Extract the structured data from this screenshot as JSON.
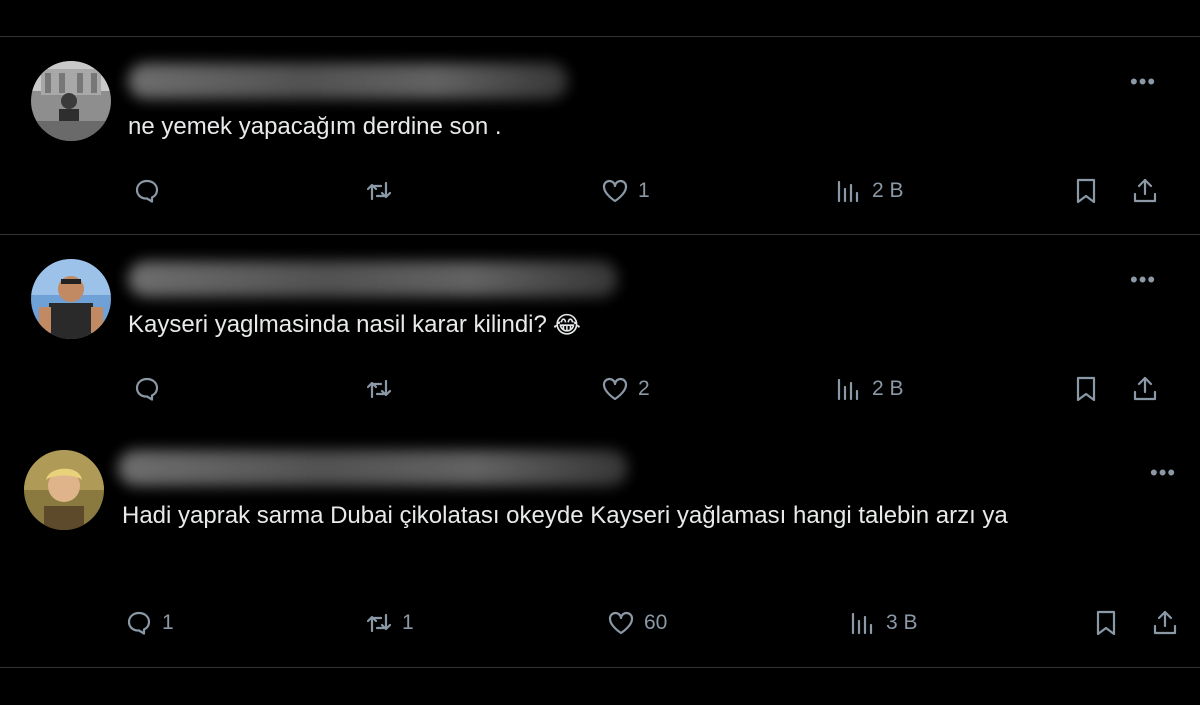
{
  "posts": [
    {
      "text": "ne yemek yapacağım derdine son .",
      "more": "•••",
      "replies": "",
      "reposts": "",
      "likes": "1",
      "views": "2 B"
    },
    {
      "text": "Kayseri yaglmasinda nasil karar kilindi?",
      "emoji": "😂",
      "more": "•••",
      "replies": "",
      "reposts": "",
      "likes": "2",
      "views": "2 B"
    },
    {
      "text": "Hadi yaprak sarma Dubai çikolatası okeyde Kayseri yağlaması hangi talebin arzı ya",
      "more": "•••",
      "replies": "1",
      "reposts": "1",
      "likes": "60",
      "views": "3 B"
    }
  ],
  "icons": {
    "reply": "speech-bubble-icon",
    "repost": "repost-arrows-icon",
    "like": "heart-icon",
    "views": "bar-chart-icon",
    "bookmark": "bookmark-icon",
    "share": "share-upload-icon"
  },
  "colors": {
    "background": "#000000",
    "text": "#e7e9ea",
    "muted": "#8b98a5",
    "divider": "#2f3336"
  }
}
